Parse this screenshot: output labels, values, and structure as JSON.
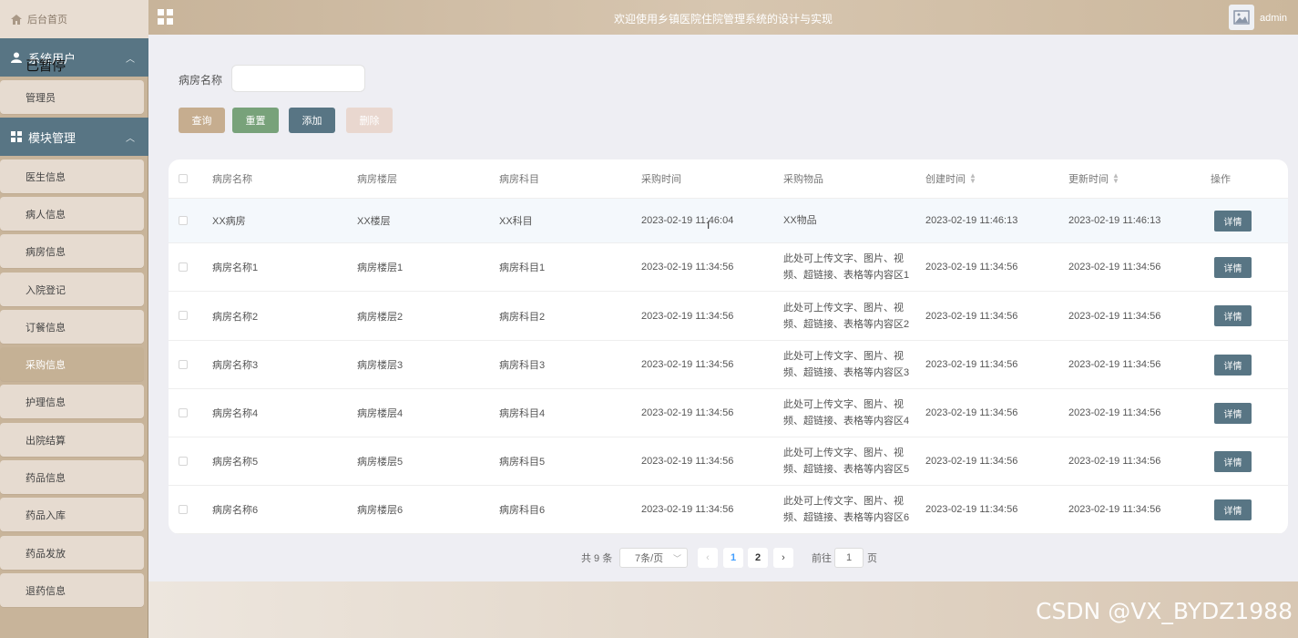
{
  "header": {
    "title": "欢迎使用乡镇医院住院管理系统的设计与实现",
    "user": "admin"
  },
  "sidebar": {
    "home": "后台首页",
    "groups": [
      {
        "label": "系统用户",
        "items": [
          "管理员"
        ]
      },
      {
        "label": "模块管理",
        "items": [
          "医生信息",
          "病人信息",
          "病房信息",
          "入院登记",
          "订餐信息",
          "采购信息",
          "护理信息",
          "出院结算",
          "药品信息",
          "药品入库",
          "药品发放",
          "退药信息"
        ]
      }
    ],
    "active_item": "采购信息",
    "overlay_text": "已暂停"
  },
  "search": {
    "label": "病房名称",
    "value": ""
  },
  "actions": {
    "query": "查询",
    "reset": "重置",
    "add": "添加",
    "delete": "删除"
  },
  "table": {
    "columns": [
      "病房名称",
      "病房楼层",
      "病房科目",
      "采购时间",
      "采购物品",
      "创建时间",
      "更新时间",
      "操作"
    ],
    "rows": [
      {
        "name": "XX病房",
        "floor": "XX楼层",
        "subject": "XX科目",
        "purchase_time": "2023-02-19 11:46:04",
        "items": "XX物品",
        "created": "2023-02-19 11:46:13",
        "updated": "2023-02-19 11:46:13",
        "action": "详情"
      },
      {
        "name": "病房名称1",
        "floor": "病房楼层1",
        "subject": "病房科目1",
        "purchase_time": "2023-02-19 11:34:56",
        "items": "此处可上传文字、图片、视频、超链接、表格等内容区1",
        "created": "2023-02-19 11:34:56",
        "updated": "2023-02-19 11:34:56",
        "action": "详情"
      },
      {
        "name": "病房名称2",
        "floor": "病房楼层2",
        "subject": "病房科目2",
        "purchase_time": "2023-02-19 11:34:56",
        "items": "此处可上传文字、图片、视频、超链接、表格等内容区2",
        "created": "2023-02-19 11:34:56",
        "updated": "2023-02-19 11:34:56",
        "action": "详情"
      },
      {
        "name": "病房名称3",
        "floor": "病房楼层3",
        "subject": "病房科目3",
        "purchase_time": "2023-02-19 11:34:56",
        "items": "此处可上传文字、图片、视频、超链接、表格等内容区3",
        "created": "2023-02-19 11:34:56",
        "updated": "2023-02-19 11:34:56",
        "action": "详情"
      },
      {
        "name": "病房名称4",
        "floor": "病房楼层4",
        "subject": "病房科目4",
        "purchase_time": "2023-02-19 11:34:56",
        "items": "此处可上传文字、图片、视频、超链接、表格等内容区4",
        "created": "2023-02-19 11:34:56",
        "updated": "2023-02-19 11:34:56",
        "action": "详情"
      },
      {
        "name": "病房名称5",
        "floor": "病房楼层5",
        "subject": "病房科目5",
        "purchase_time": "2023-02-19 11:34:56",
        "items": "此处可上传文字、图片、视频、超链接、表格等内容区5",
        "created": "2023-02-19 11:34:56",
        "updated": "2023-02-19 11:34:56",
        "action": "详情"
      },
      {
        "name": "病房名称6",
        "floor": "病房楼层6",
        "subject": "病房科目6",
        "purchase_time": "2023-02-19 11:34:56",
        "items": "此处可上传文字、图片、视频、超链接、表格等内容区6",
        "created": "2023-02-19 11:34:56",
        "updated": "2023-02-19 11:34:56",
        "action": "详情"
      }
    ]
  },
  "pagination": {
    "total": "共 9 条",
    "page_size": "7条/页",
    "pages": [
      "1",
      "2"
    ],
    "current": "1",
    "goto_label": "前往",
    "goto_value": "1",
    "page_suffix": "页"
  },
  "watermark": "CSDN @VX_BYDZ1988",
  "colors": {
    "accent": "#c8b49a",
    "group_bg": "#587584",
    "primary_btn": "#587584",
    "reset_btn": "#78a27a",
    "query_btn": "#c6ad8f",
    "delete_btn": "#e9d7cf"
  }
}
